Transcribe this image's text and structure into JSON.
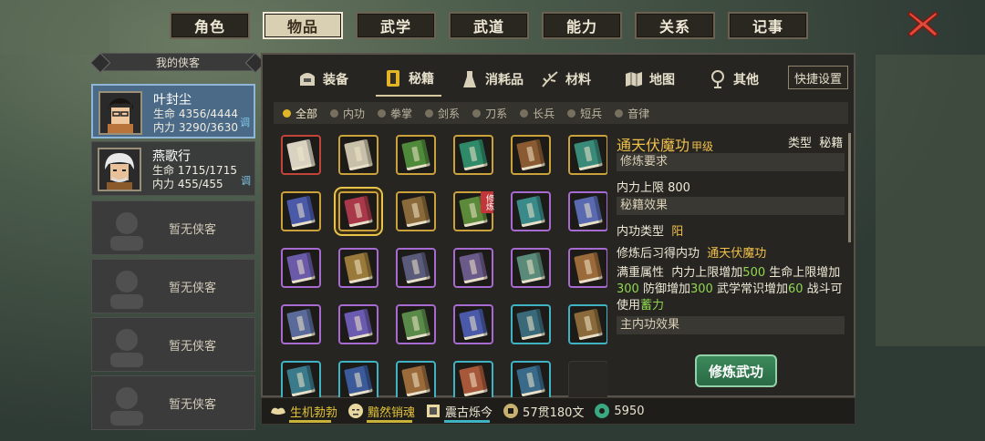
{
  "tabs": [
    "角色",
    "物品",
    "武学",
    "武道",
    "能力",
    "关系",
    "记事"
  ],
  "active_tab": "物品",
  "left": {
    "header": "我的侠客",
    "heroes": [
      {
        "name": "叶封尘",
        "hp_label": "生命",
        "hp": "4356/4444",
        "mp_label": "内力",
        "mp": "3290/3630",
        "action": "调"
      },
      {
        "name": "燕歌行",
        "hp_label": "生命",
        "hp": "1715/1715",
        "mp_label": "内力",
        "mp": "455/455",
        "action": "调"
      }
    ],
    "empty_slots": [
      "暂无侠客",
      "暂无侠客",
      "暂无侠客",
      "暂无侠客"
    ]
  },
  "categories": [
    {
      "label": "装备",
      "icon": "equipment-icon"
    },
    {
      "label": "秘籍",
      "icon": "manual-icon"
    },
    {
      "label": "消耗品",
      "icon": "potion-icon"
    },
    {
      "label": "材料",
      "icon": "material-icon"
    },
    {
      "label": "地图",
      "icon": "map-icon"
    },
    {
      "label": "其他",
      "icon": "misc-icon"
    }
  ],
  "active_category": "秘籍",
  "quick_settings": "快捷设置",
  "filters": [
    "全部",
    "内功",
    "拳掌",
    "剑系",
    "刀系",
    "长兵",
    "短兵",
    "音律"
  ],
  "active_filter": "全部",
  "items": [
    {
      "border": "red",
      "color": "#d9d2c0"
    },
    {
      "border": "gold",
      "color": "#c8c0a8"
    },
    {
      "border": "gold",
      "color": "#4f8a3a"
    },
    {
      "border": "gold",
      "color": "#2f8a6a"
    },
    {
      "border": "gold",
      "color": "#8a5a32"
    },
    {
      "border": "gold",
      "color": "#3a8a7a"
    },
    {
      "border": "gold",
      "color": "#4a5aa8"
    },
    {
      "border": "gold",
      "color": "#a8384a",
      "selected": true
    },
    {
      "border": "gold",
      "color": "#8a6a3a"
    },
    {
      "border": "gold",
      "color": "#5a8a3a",
      "tag": "修炼"
    },
    {
      "border": "purple",
      "color": "#3a8a8a"
    },
    {
      "border": "purple",
      "color": "#5a6ab0"
    },
    {
      "border": "purple",
      "color": "#6a5aa8"
    },
    {
      "border": "purple",
      "color": "#9a7a3a"
    },
    {
      "border": "purple",
      "color": "#5a5a7a"
    },
    {
      "border": "purple",
      "color": "#6a5a8a"
    },
    {
      "border": "purple",
      "color": "#5a8a7a"
    },
    {
      "border": "purple",
      "color": "#9a6a3a"
    },
    {
      "border": "purple",
      "color": "#5a6a9a"
    },
    {
      "border": "purple",
      "color": "#6a5ab0"
    },
    {
      "border": "purple",
      "color": "#5a8a4a"
    },
    {
      "border": "purple",
      "color": "#4a5aa8"
    },
    {
      "border": "teal",
      "color": "#3a6a7a"
    },
    {
      "border": "teal",
      "color": "#8a6a3a"
    },
    {
      "border": "teal",
      "color": "#3a7a8a"
    },
    {
      "border": "teal",
      "color": "#3a5a9a"
    },
    {
      "border": "teal",
      "color": "#9a6a3a"
    },
    {
      "border": "teal",
      "color": "#a8583a"
    },
    {
      "border": "teal",
      "color": "#3a6a8a"
    },
    {
      "border": "none",
      "color": ""
    }
  ],
  "detail": {
    "name": "通天伏魔功",
    "grade": "甲级",
    "type_label": "类型",
    "type_value": "秘籍",
    "req_header": "修炼要求",
    "req_line": "内力上限  800",
    "effect_header": "秘籍效果",
    "inner_type_label": "内功类型",
    "inner_type_value": "阳",
    "learn_label": "修炼后习得内功",
    "learn_value": "通天伏魔功",
    "full_label": "满重属性",
    "full_t1": "内力上限增加",
    "full_v1": "500",
    "full_t2": "生命上限增",
    "full_t3": "加",
    "full_v2": "300",
    "full_t4": "防御增加",
    "full_v3": "300",
    "full_t5": "武学常识",
    "full_t6": "增加",
    "full_v4": "60",
    "full_t7": "战斗可使用",
    "full_v5": "蓄力",
    "main_header": "主内功效果",
    "button": "修炼武功"
  },
  "bottom": {
    "status1": "生机勃勃",
    "status2": "黯然销魂",
    "status3": "震古烁今",
    "money": "57贯180文",
    "gems": "5950"
  },
  "colors": {
    "accent_gold": "#f1c04a",
    "accent_green": "#8fd650",
    "button": "#2f7a4e"
  }
}
